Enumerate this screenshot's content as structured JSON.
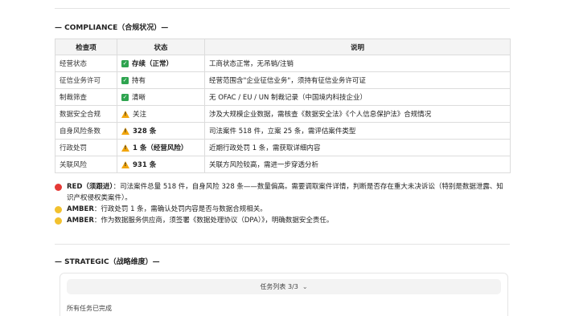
{
  "compliance": {
    "section_title": "— COMPLIANCE（合规状况）—",
    "headers": [
      "检查项",
      "状态",
      "说明"
    ],
    "rows": [
      {
        "item": "经营状态",
        "status": "存续（正常）",
        "status_icon": "check-icon",
        "bold": true,
        "desc": "工商状态正常，无吊销/注销"
      },
      {
        "item": "征信业务许可",
        "status": "持有",
        "status_icon": "check-icon",
        "bold": false,
        "desc": "经营范围含\"企业征信业务\"，须持有征信业务许可证"
      },
      {
        "item": "制裁筛查",
        "status": "清晰",
        "status_icon": "check-icon",
        "bold": false,
        "desc": "无 OFAC / EU / UN 制裁记录（中国境内科技企业）"
      },
      {
        "item": "数据安全合规",
        "status": "关注",
        "status_icon": "warning-icon",
        "bold": false,
        "desc": "涉及大规模企业数据，需核查《数据安全法》《个人信息保护法》合规情况"
      },
      {
        "item": "自身风险条数",
        "status": "328 条",
        "status_icon": "warning-icon",
        "bold": true,
        "desc": "司法案件 518 件，立案 25 条，需评估案件类型"
      },
      {
        "item": "行政处罚",
        "status": "1 条（经营风险）",
        "status_icon": "warning-icon",
        "bold": true,
        "desc": "近期行政处罚 1 条，需获取详细内容"
      },
      {
        "item": "关联风险",
        "status": "931 条",
        "status_icon": "warning-icon",
        "bold": true,
        "desc": "关联方风险较高，需进一步穿透分析"
      }
    ],
    "notes": [
      {
        "color": "#e53935",
        "level": "RED（须跟进）",
        "text": "：司法案件总量 518 件，自身风险 328 条——数量偏高。需要调取案件详情，判断是否存在重大未决诉讼（特别是数据泄露、知识产权侵权类案件）。"
      },
      {
        "color": "#f2c12e",
        "level": "AMBER",
        "text": "：行政处罚 1 条，需确认处罚内容是否与数据合规相关。"
      },
      {
        "color": "#f2c12e",
        "level": "AMBER",
        "text": "：作为数据服务供应商，须签署《数据处理协议（DPA）》，明确数据安全责任。"
      }
    ]
  },
  "strategic": {
    "section_title": "— STRATEGIC（战略维度）—",
    "task_list_label": "任务列表 3/3",
    "task_status": "所有任务已完成"
  }
}
